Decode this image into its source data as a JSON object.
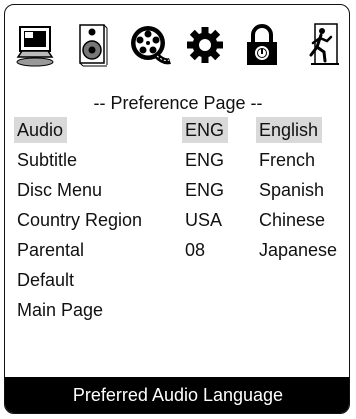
{
  "toolbar": {
    "icons": [
      {
        "name": "monitor-icon"
      },
      {
        "name": "speaker-icon"
      },
      {
        "name": "disc-reel-icon"
      },
      {
        "name": "gear-icon"
      },
      {
        "name": "padlock-icon"
      },
      {
        "name": "exit-running-man-icon"
      }
    ]
  },
  "page_title": "-- Preference Page --",
  "menu": {
    "items": [
      {
        "label": "Audio",
        "code": "ENG",
        "option": "English",
        "selected": true
      },
      {
        "label": "Subtitle",
        "code": "ENG",
        "option": "French"
      },
      {
        "label": "Disc Menu",
        "code": "ENG",
        "option": "Spanish"
      },
      {
        "label": "Country Region",
        "code": "USA",
        "option": "Chinese"
      },
      {
        "label": "Parental",
        "code": "08",
        "option": "Japanese"
      },
      {
        "label": "Default",
        "code": "",
        "option": ""
      },
      {
        "label": "Main Page",
        "code": "",
        "option": ""
      }
    ]
  },
  "status_bar": {
    "text": "Preferred Audio Language"
  },
  "colors": {
    "highlight": "#d9d9d9",
    "status_background": "#000000",
    "status_text": "#ffffff"
  }
}
